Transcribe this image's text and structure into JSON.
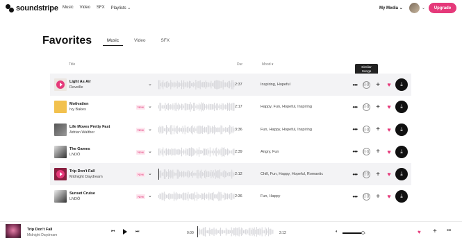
{
  "nav": {
    "logo": "soundstripe",
    "links": [
      "Music",
      "Video",
      "SFX",
      "Playlists"
    ],
    "my_media": "My Media",
    "upgrade": "Upgrade"
  },
  "page": {
    "title": "Favorites",
    "tabs": [
      "Music",
      "Video",
      "SFX"
    ],
    "active_tab": "Music"
  },
  "columns": {
    "title": "Title",
    "dur": "Dur",
    "mood": "Mood"
  },
  "tooltip": {
    "line1": "Similar",
    "line2": "Songs"
  },
  "tracks": [
    {
      "title": "Light As Air",
      "artist": "Reveille",
      "new": "",
      "duration": "2:37",
      "mood": "Inspiring, Hopeful"
    },
    {
      "title": "Motivation",
      "artist": "Ivy Bakes",
      "new": "New",
      "duration": "2:17",
      "mood": "Happy, Fun, Hopeful, Inspiring"
    },
    {
      "title": "Life Moves Pretty Fast",
      "artist": "Adrian Walther",
      "new": "New",
      "duration": "3:36",
      "mood": "Fun, Happy, Hopeful, Inspiring"
    },
    {
      "title": "The Games",
      "artist": "LNDÖ",
      "new": "New",
      "duration": "2:39",
      "mood": "Angry, Fun"
    },
    {
      "title": "Trip Don't Fall",
      "artist": "Midnight Daydream",
      "new": "New",
      "duration": "2:12",
      "mood": "Chill, Fun, Happy, Hopeful, Romantic"
    },
    {
      "title": "Sunset Cruise",
      "artist": "LNDÖ",
      "new": "New",
      "duration": "2:36",
      "mood": "Fun, Happy"
    }
  ],
  "player": {
    "title": "Trip Don't Fall",
    "artist": "Midnight Daydream",
    "elapsed": "0:00",
    "total": "2:12",
    "volume": 0.9
  },
  "colors": {
    "accent": "#e5397a",
    "dark": "#111111"
  }
}
